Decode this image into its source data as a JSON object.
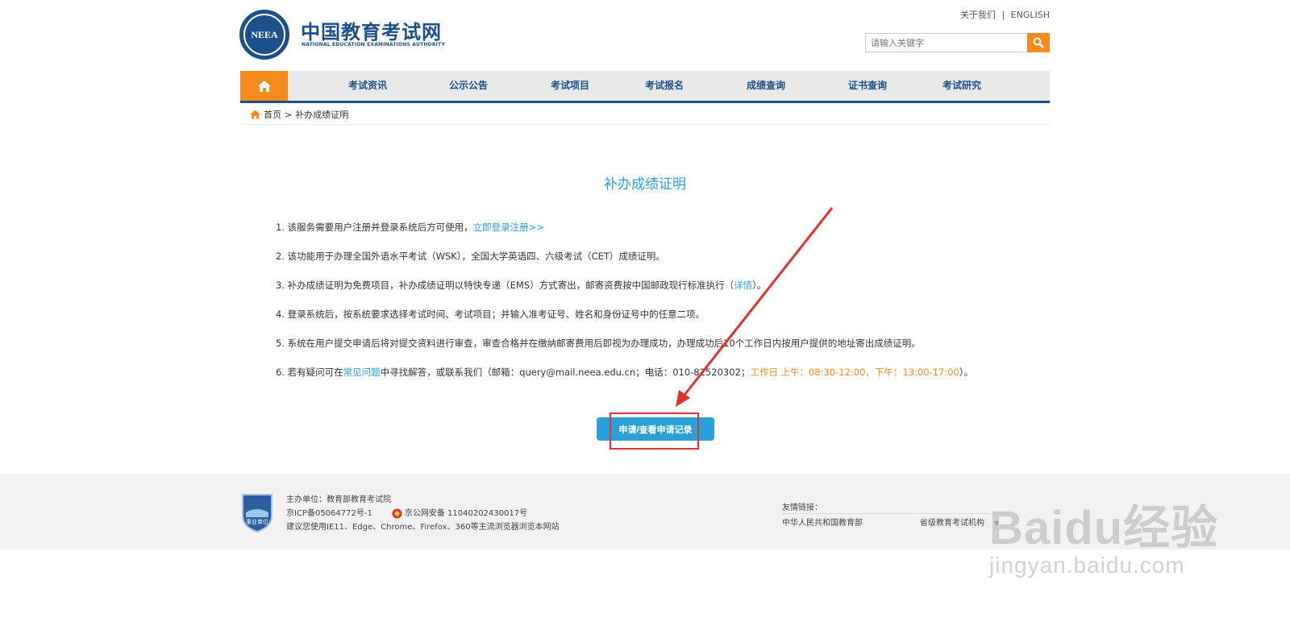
{
  "header": {
    "logo_text": "NEEA",
    "site_name": "中国教育考试网",
    "site_sub": "NATIONAL EDUCATION EXAMINATIONS AUTHORITY",
    "top_links": [
      "关于我们",
      "|",
      "ENGLISH"
    ],
    "search_placeholder": "请输入关键字"
  },
  "nav": {
    "items": [
      "考试资讯",
      "公示公告",
      "考试项目",
      "考试报名",
      "成绩查询",
      "证书查询",
      "考试研究"
    ]
  },
  "breadcrumb": {
    "home": "首页",
    "sep": ">",
    "current": "补办成绩证明"
  },
  "main": {
    "title": "补办成绩证明",
    "items": [
      {
        "text": "1. 该服务需要用户注册并登录系统后方可使用，",
        "link": "立即登录注册>>"
      },
      {
        "text": "2. 该功能用于办理全国外语水平考试（WSK），全国大学英语四、六级考试（CET）成绩证明。"
      },
      {
        "text": "3. 补办成绩证明为免费项目，补办成绩证明以特快专递（EMS）方式寄出，邮寄资费按中国邮政现行标准执行（",
        "link": "详情",
        "after": "）。"
      },
      {
        "text": "4. 登录系统后，按系统要求选择考试时间、考试项目；并输入准考证号、姓名和身份证号中的任意二项。"
      },
      {
        "text": "5. 系统在用户提交申请后将对提交资料进行审查，审查合格并在缴纳邮寄费用后即视为办理成功，办理成功后10个工作日内按用户提供的地址寄出成绩证明。"
      },
      {
        "text": "6. 若有疑问可在",
        "link": "常见问题",
        "mid": "中寻找解答，或联系我们（邮箱：query@mail.neea.edu.cn；电话：010-82520302；",
        "hours": "工作日 上午：08:30-12:00，下午：13:00-17:00",
        "after": "）。"
      }
    ],
    "apply_button": "申请/查看申请记录"
  },
  "footer": {
    "badge_text": "事业单位",
    "sponsor": "主办单位：教育部教育考试院",
    "icp": "京ICP备05064772号-1",
    "police": "京公网安备 11040202430017号",
    "browser": "建议您使用IE11、Edge、Chrome、Firefox、360等主流浏览器浏览本网站",
    "friend_links_title": "友情链接：",
    "friend_link_1": "中华人民共和国教育部",
    "friend_link_2": "省级教育考试机构"
  },
  "watermark": {
    "main": "Baidu经验",
    "sub": "jingyan.baidu.com"
  },
  "colors": {
    "brand_blue": "#1d4f8c",
    "accent_orange": "#f58a1f",
    "link_blue": "#2aa0d8",
    "annotation_red": "#e53030"
  }
}
